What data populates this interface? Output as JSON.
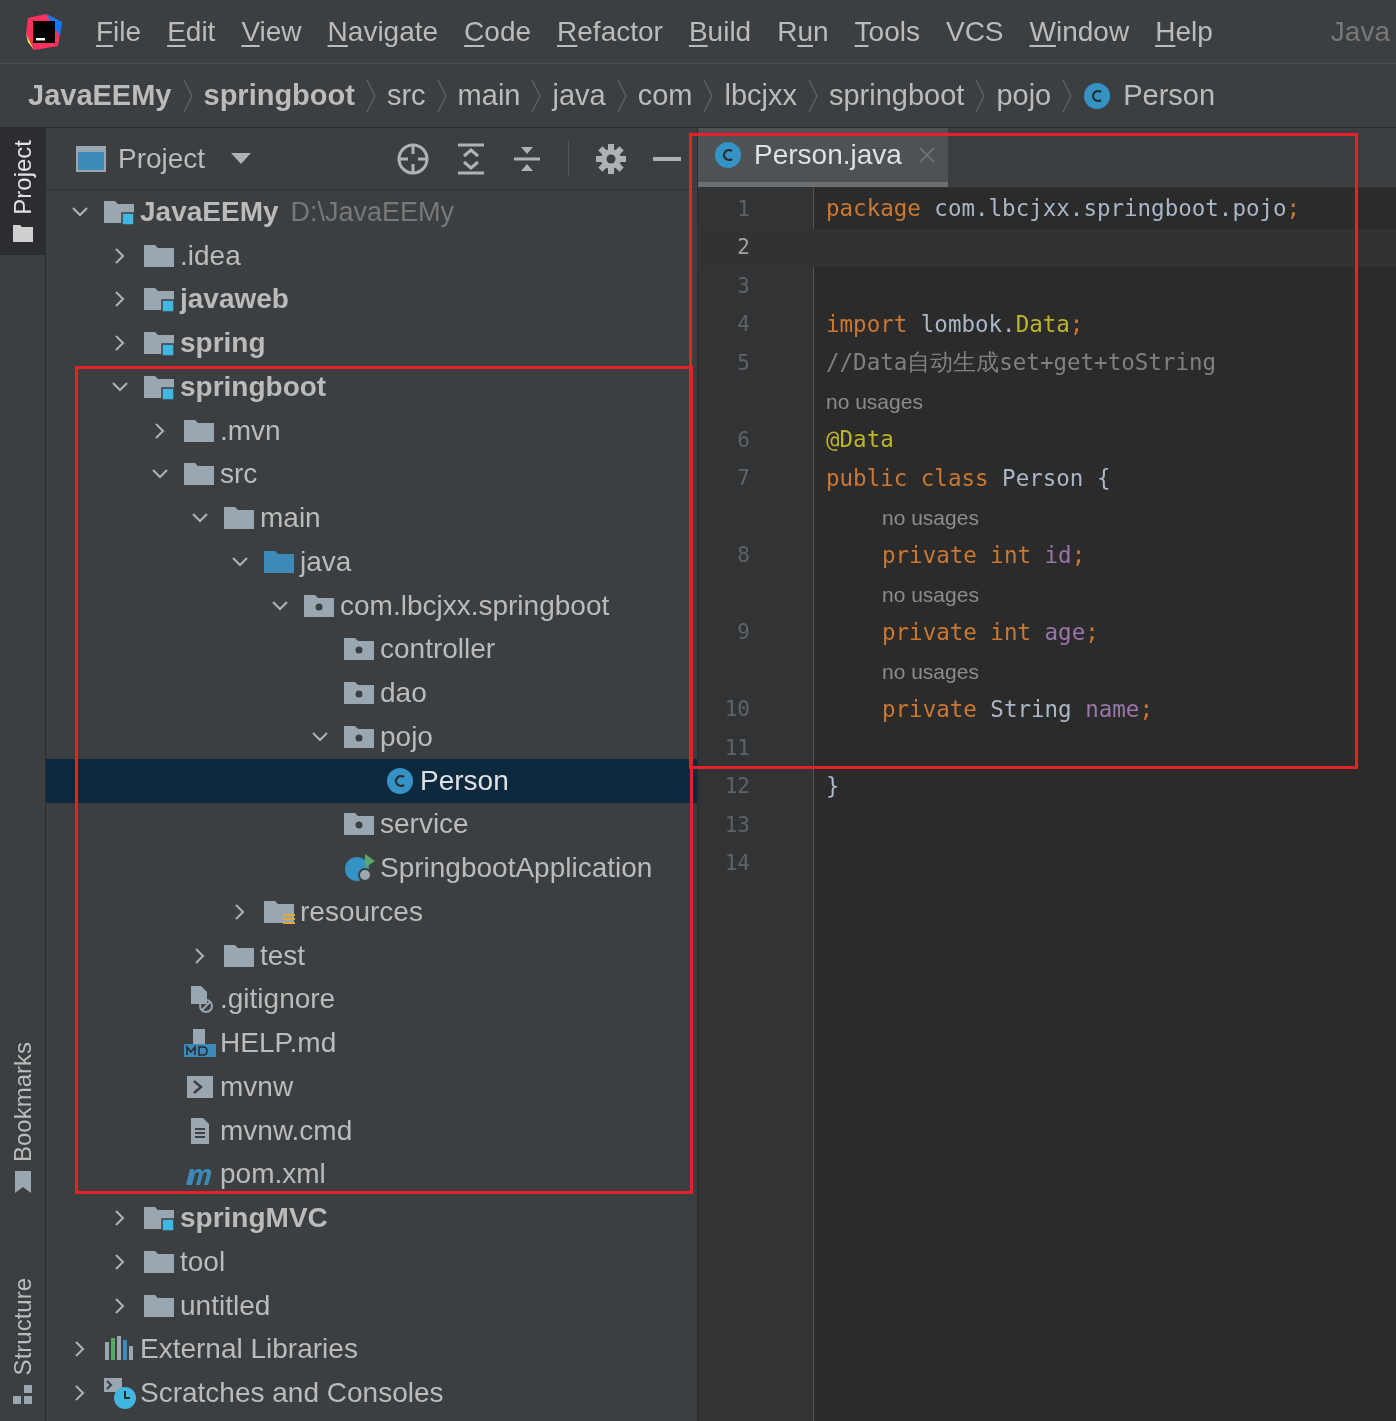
{
  "menu": {
    "items": [
      {
        "parts": [
          {
            "text": "F",
            "underlined": true
          },
          {
            "text": "ile",
            "underlined": false
          }
        ]
      },
      {
        "parts": [
          {
            "text": "E",
            "underlined": true
          },
          {
            "text": "dit",
            "underlined": false
          }
        ]
      },
      {
        "parts": [
          {
            "text": "V",
            "underlined": true
          },
          {
            "text": "iew",
            "underlined": false
          }
        ]
      },
      {
        "parts": [
          {
            "text": "N",
            "underlined": true
          },
          {
            "text": "avigate",
            "underlined": false
          }
        ]
      },
      {
        "parts": [
          {
            "text": "C",
            "underlined": true
          },
          {
            "text": "ode",
            "underlined": false
          }
        ]
      },
      {
        "parts": [
          {
            "text": "R",
            "underlined": true
          },
          {
            "text": "efactor",
            "underlined": false
          }
        ]
      },
      {
        "parts": [
          {
            "text": "B",
            "underlined": true
          },
          {
            "text": "uild",
            "underlined": false
          }
        ]
      },
      {
        "parts": [
          {
            "text": "R",
            "underlined": false
          },
          {
            "text": "u",
            "underlined": true
          },
          {
            "text": "n",
            "underlined": false
          }
        ]
      },
      {
        "parts": [
          {
            "text": "T",
            "underlined": true
          },
          {
            "text": "ools",
            "underlined": false
          }
        ]
      },
      {
        "parts": [
          {
            "text": "VCS",
            "underlined": false
          }
        ]
      },
      {
        "parts": [
          {
            "text": "W",
            "underlined": true
          },
          {
            "text": "indow",
            "underlined": false
          }
        ]
      },
      {
        "parts": [
          {
            "text": "H",
            "underlined": true
          },
          {
            "text": "elp",
            "underlined": false
          }
        ]
      }
    ],
    "window_title": "Java"
  },
  "breadcrumbs": [
    {
      "label": "JavaEEMy",
      "kind": "module"
    },
    {
      "label": "springboot",
      "kind": "module"
    },
    {
      "label": "src",
      "kind": "plain"
    },
    {
      "label": "main",
      "kind": "plain"
    },
    {
      "label": "java",
      "kind": "plain"
    },
    {
      "label": "com",
      "kind": "plain"
    },
    {
      "label": "lbcjxx",
      "kind": "plain"
    },
    {
      "label": "springboot",
      "kind": "plain"
    },
    {
      "label": "pojo",
      "kind": "plain"
    },
    {
      "label": "Person",
      "kind": "class"
    }
  ],
  "side_tabs": [
    {
      "label": "Project",
      "selected": true,
      "kind": "project"
    },
    {
      "label": "Bookmarks",
      "selected": false,
      "kind": "bookmarks"
    },
    {
      "label": "Structure",
      "selected": false,
      "kind": "structure"
    }
  ],
  "project_panel": {
    "title": "Project"
  },
  "tree": [
    {
      "label": "JavaEEMy",
      "path": "D:\\JavaEEMy",
      "kind": "module",
      "expanded": true,
      "selected": false,
      "children": [
        {
          "label": ".idea",
          "kind": "folder",
          "expanded": false,
          "selected": false
        },
        {
          "label": "javaweb",
          "kind": "module",
          "expanded": false,
          "selected": false
        },
        {
          "label": "spring",
          "kind": "module",
          "expanded": false,
          "selected": false
        },
        {
          "label": "springboot",
          "kind": "module",
          "expanded": true,
          "selected": false,
          "children": [
            {
              "label": ".mvn",
              "kind": "folder",
              "expanded": false,
              "selected": false
            },
            {
              "label": "src",
              "kind": "folder",
              "expanded": true,
              "selected": false,
              "children": [
                {
                  "label": "main",
                  "kind": "folder",
                  "expanded": true,
                  "selected": false,
                  "children": [
                    {
                      "label": "java",
                      "kind": "source",
                      "expanded": true,
                      "selected": false,
                      "children": [
                        {
                          "label": "com.lbcjxx.springboot",
                          "kind": "package",
                          "expanded": true,
                          "selected": false,
                          "children": [
                            {
                              "label": "controller",
                              "kind": "package",
                              "selected": false
                            },
                            {
                              "label": "dao",
                              "kind": "package",
                              "selected": false
                            },
                            {
                              "label": "pojo",
                              "kind": "package",
                              "expanded": true,
                              "selected": false,
                              "children": [
                                {
                                  "label": "Person",
                                  "kind": "class",
                                  "selected": true
                                }
                              ]
                            },
                            {
                              "label": "service",
                              "kind": "package",
                              "selected": false
                            },
                            {
                              "label": "SpringbootApplication",
                              "kind": "app",
                              "selected": false
                            }
                          ]
                        }
                      ]
                    },
                    {
                      "label": "resources",
                      "kind": "resources",
                      "expanded": false,
                      "selected": false
                    }
                  ]
                },
                {
                  "label": "test",
                  "kind": "folder",
                  "expanded": false,
                  "selected": false
                }
              ]
            },
            {
              "label": ".gitignore",
              "kind": "gitignore",
              "selected": false
            },
            {
              "label": "HELP.md",
              "kind": "markdown",
              "selected": false
            },
            {
              "label": "mvnw",
              "kind": "script",
              "selected": false
            },
            {
              "label": "mvnw.cmd",
              "kind": "text",
              "selected": false
            },
            {
              "label": "pom.xml",
              "kind": "maven",
              "selected": false
            }
          ]
        },
        {
          "label": "springMVC",
          "kind": "module",
          "expanded": false,
          "selected": false
        },
        {
          "label": "tool",
          "kind": "folder",
          "expanded": false,
          "selected": false
        },
        {
          "label": "untitled",
          "kind": "folder",
          "expanded": false,
          "selected": false
        }
      ]
    },
    {
      "label": "External Libraries",
      "kind": "libraries",
      "expanded": false,
      "selected": false
    },
    {
      "label": "Scratches and Consoles",
      "kind": "scratches",
      "expanded": false,
      "selected": false
    }
  ],
  "editor": {
    "tabs": [
      {
        "label": "Person.java",
        "selected": true
      }
    ],
    "lines": [
      {
        "kind": "code",
        "number": "1",
        "current": false,
        "tokens": [
          {
            "text": "package",
            "kind": "keyword"
          },
          {
            "text": " com.lbcjxx.springboot.pojo",
            "kind": "plain"
          },
          {
            "text": ";",
            "kind": "keyword"
          }
        ]
      },
      {
        "kind": "code",
        "number": "2",
        "current": true
      },
      {
        "kind": "code",
        "number": "3",
        "current": false
      },
      {
        "kind": "code",
        "number": "4",
        "current": false,
        "tokens": [
          {
            "text": "import",
            "kind": "keyword"
          },
          {
            "text": " lombok.",
            "kind": "plain"
          },
          {
            "text": "Data",
            "kind": "annotation"
          },
          {
            "text": ";",
            "kind": "keyword"
          }
        ]
      },
      {
        "kind": "code",
        "number": "5",
        "current": false,
        "tokens": [
          {
            "text": "//Data自动生成set+get+toString",
            "kind": "comment"
          }
        ]
      },
      {
        "kind": "hint",
        "text": "no usages",
        "indented": false
      },
      {
        "kind": "code",
        "number": "6",
        "current": false,
        "tokens": [
          {
            "text": "@Data",
            "kind": "annotation"
          }
        ]
      },
      {
        "kind": "code",
        "number": "7",
        "current": false,
        "tokens": [
          {
            "text": "public class",
            "kind": "keyword"
          },
          {
            "text": " Person {",
            "kind": "plain"
          }
        ]
      },
      {
        "kind": "hint",
        "text": "no usages",
        "indented": true
      },
      {
        "kind": "code",
        "number": "8",
        "current": false,
        "indented": true,
        "tokens": [
          {
            "text": "private int",
            "kind": "keyword"
          },
          {
            "text": " id",
            "kind": "field"
          },
          {
            "text": ";",
            "kind": "keyword"
          }
        ]
      },
      {
        "kind": "hint",
        "text": "no usages",
        "indented": true
      },
      {
        "kind": "code",
        "number": "9",
        "current": false,
        "indented": true,
        "tokens": [
          {
            "text": "private int",
            "kind": "keyword"
          },
          {
            "text": " age",
            "kind": "field"
          },
          {
            "text": ";",
            "kind": "keyword"
          }
        ]
      },
      {
        "kind": "hint",
        "text": "no usages",
        "indented": true
      },
      {
        "kind": "code",
        "number": "10",
        "current": false,
        "indented": true,
        "tokens": [
          {
            "text": "private",
            "kind": "keyword"
          },
          {
            "text": " String ",
            "kind": "plain"
          },
          {
            "text": "name",
            "kind": "field"
          },
          {
            "text": ";",
            "kind": "keyword"
          }
        ]
      },
      {
        "kind": "code",
        "number": "11",
        "current": false
      },
      {
        "kind": "code",
        "number": "12",
        "current": false,
        "tokens": [
          {
            "text": "}",
            "kind": "plain"
          }
        ]
      },
      {
        "kind": "code",
        "number": "13",
        "current": false
      },
      {
        "kind": "code",
        "number": "14",
        "current": false
      }
    ]
  }
}
